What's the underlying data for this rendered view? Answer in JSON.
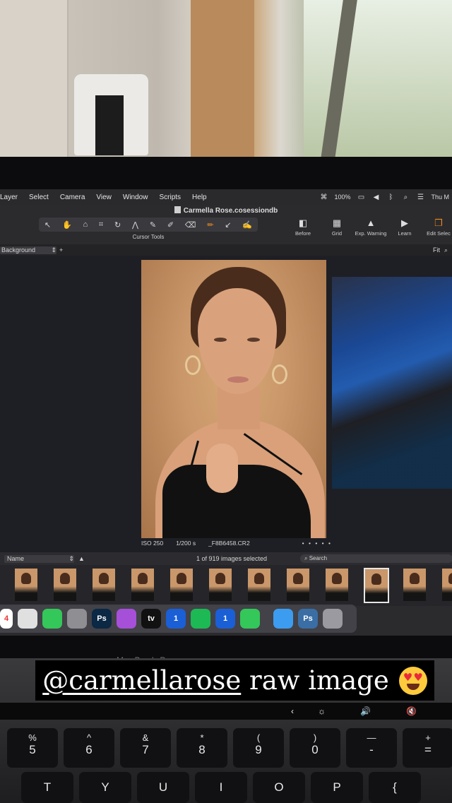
{
  "menubar": {
    "items": [
      "Layer",
      "Select",
      "Camera",
      "View",
      "Window",
      "Scripts",
      "Help"
    ],
    "battery": "100%",
    "clock": "Thu M"
  },
  "document_title": "Carmella Rose.cosessiondb",
  "toolbar": {
    "label": "Cursor Tools",
    "tools": [
      "select-icon",
      "pan-icon",
      "loupe-icon",
      "crop-icon",
      "rotate-icon",
      "keystone-icon",
      "picker-icon",
      "brush-icon",
      "erase-icon",
      "draw-mask-icon",
      "pen-icon",
      "gradient-icon",
      "annotate-icon"
    ],
    "active_tool_color": "#f08a1e",
    "right": [
      {
        "label": "Before",
        "icon": "before-icon"
      },
      {
        "label": "Grid",
        "icon": "grid-icon"
      },
      {
        "label": "Exp. Warning",
        "icon": "warning-icon"
      },
      {
        "label": "Learn",
        "icon": "learn-icon"
      },
      {
        "label": "Edit Selec",
        "icon": "edit-selected-icon"
      }
    ]
  },
  "layer": {
    "selected": "Background",
    "zoom": "Fit"
  },
  "viewer": {
    "iso": "ISO 250",
    "shutter": "1/200 s",
    "filename": "_F8B6458.CR2",
    "dots": "• • • • •"
  },
  "browser": {
    "sort_by": "Name",
    "selection_count": "1 of 919 images selected",
    "search_placeholder": "Search"
  },
  "filmstrip": {
    "count_visible": 12,
    "selected_index": 9
  },
  "dock": {
    "apps": [
      {
        "name": "calendar",
        "label": "4",
        "color": "#ffffff"
      },
      {
        "name": "chrome",
        "label": "",
        "color": "#e0e0e0"
      },
      {
        "name": "messages",
        "label": "",
        "color": "#34c759"
      },
      {
        "name": "settings",
        "label": "",
        "color": "#8e8e93"
      },
      {
        "name": "photoshop",
        "label": "Ps",
        "color": "#0b2844"
      },
      {
        "name": "podcasts",
        "label": "",
        "color": "#a64fd8"
      },
      {
        "name": "apple-tv",
        "label": "tv",
        "color": "#111111"
      },
      {
        "name": "1password",
        "label": "1",
        "color": "#1a5fd6"
      },
      {
        "name": "spotify",
        "label": "",
        "color": "#1db954"
      },
      {
        "name": "1password-2",
        "label": "1",
        "color": "#1a5fd6"
      },
      {
        "name": "facetime",
        "label": "",
        "color": "#34c759"
      },
      {
        "name": "finder-folder",
        "label": "",
        "color": "#3c9cf0"
      },
      {
        "name": "photoshop-doc",
        "label": "Ps",
        "color": "#3a6ea5"
      },
      {
        "name": "trash",
        "label": "",
        "color": "#9a9aa0"
      }
    ]
  },
  "caption": {
    "handle": "@carmellarose",
    "text": "raw image",
    "emoji": "heart-eyes-emoji"
  },
  "laptop_brand": "MacBook Pro",
  "touchbar": [
    "‹",
    "☼",
    "🔊",
    "🔇"
  ],
  "keyboard": {
    "row1": [
      {
        "top": "%",
        "main": "5"
      },
      {
        "top": "^",
        "main": "6"
      },
      {
        "top": "&",
        "main": "7"
      },
      {
        "top": "*",
        "main": "8"
      },
      {
        "top": "(",
        "main": "9"
      },
      {
        "top": ")",
        "main": "0"
      },
      {
        "top": "—",
        "main": "-"
      },
      {
        "top": "+",
        "main": "="
      }
    ],
    "row2": [
      "T",
      "Y",
      "U",
      "I",
      "O",
      "P",
      "{"
    ]
  }
}
